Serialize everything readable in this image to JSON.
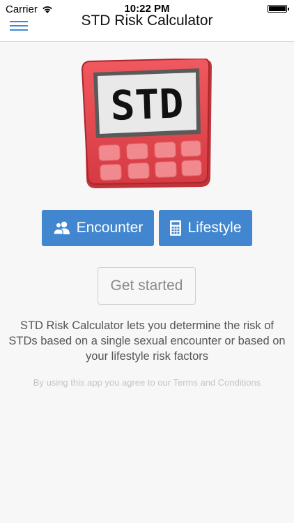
{
  "status_bar": {
    "carrier": "Carrier",
    "time": "10:22 PM"
  },
  "nav": {
    "title": "STD Risk Calculator",
    "menu_icon": "hamburger-menu-icon"
  },
  "logo": {
    "text": "STD",
    "body_color": "#e8474d",
    "key_color": "#f08a8e",
    "screen_color": "#e9e9e9"
  },
  "buttons": {
    "encounter": {
      "label": "Encounter",
      "icon": "users-icon"
    },
    "lifestyle": {
      "label": "Lifestyle",
      "icon": "calculator-icon"
    },
    "get_started": "Get started"
  },
  "description": "STD Risk Calculator lets you determine the risk of STDs based on a single sexual encounter or based on your lifestyle risk factors",
  "terms_text": "By using this app you agree to our Terms and Conditions",
  "colors": {
    "accent": "#4186cf",
    "background": "#f7f7f7"
  }
}
